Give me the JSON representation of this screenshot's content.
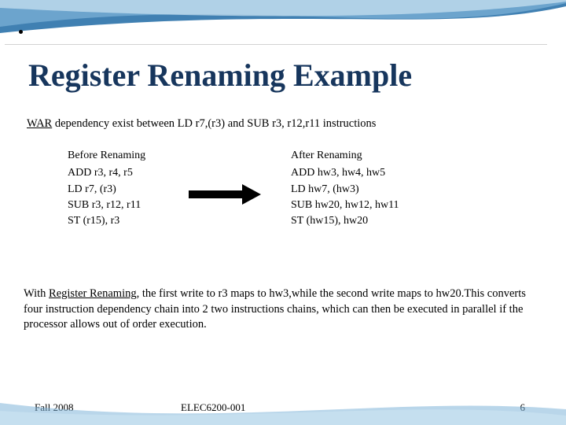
{
  "title": "Register Renaming Example",
  "body1_pre": "WAR",
  "body1_post": " dependency exist between LD r7,(r3) and SUB r3, r12,r11 instructions",
  "diagram": {
    "left_header": "Before Renaming",
    "left_lines": [
      "ADD r3, r4, r5",
      "LD r7, (r3)",
      "SUB r3, r12, r11",
      "ST (r15), r3"
    ],
    "right_header": "After Renaming",
    "right_lines": [
      "ADD hw3, hw4, hw5",
      "LD hw7, (hw3)",
      "SUB hw20, hw12, hw11",
      "ST (hw15), hw20"
    ]
  },
  "body2_pre": "With ",
  "body2_underlined": "Register Renaming",
  "body2_post": ", the first write to r3 maps to hw3,while the second write maps to hw20.This converts four instruction dependency chain into 2 two instructions chains, which can then be executed in parallel if the processor allows out of order execution.",
  "footer": {
    "left": "Fall 2008",
    "center": "ELEC6200-001",
    "right": "6"
  }
}
